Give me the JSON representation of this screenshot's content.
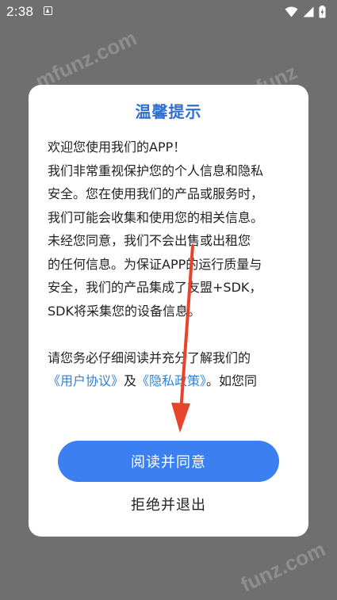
{
  "status_bar": {
    "time": "2:38",
    "icons": [
      "notification-icon",
      "wifi-icon",
      "signal-icon",
      "battery-charging-icon"
    ]
  },
  "dialog": {
    "title": "温馨提示",
    "paragraph1": [
      "欢迎您使用我们的APP！",
      "我们非常重视保护您的个人信息和隐私",
      "安全。您在使用我们的产品或服务时，",
      "我们可能会收集和使用您的相关信息。",
      "未经您同意，我们不会出售或出租您",
      "的任何信息。为保证APP的运行质量与",
      "安全，我们的产品集成了友盟+SDK，",
      "SDK将采集您的设备信息。"
    ],
    "paragraph2_line1": "请您务必仔细阅读并充分了解我们的",
    "user_agreement_link": "《用户协议》",
    "conjunction": "及",
    "privacy_policy_link": "《隐私政策》",
    "paragraph2_tail": "。如您同",
    "agree_button": "阅读并同意",
    "reject_button": "拒绝并退出"
  },
  "colors": {
    "overlay": "#6f6f6f",
    "title": "#2f6fd0",
    "link": "#2f83d6",
    "button": "#3b7ff0",
    "annotation_arrow": "#e8442c"
  }
}
